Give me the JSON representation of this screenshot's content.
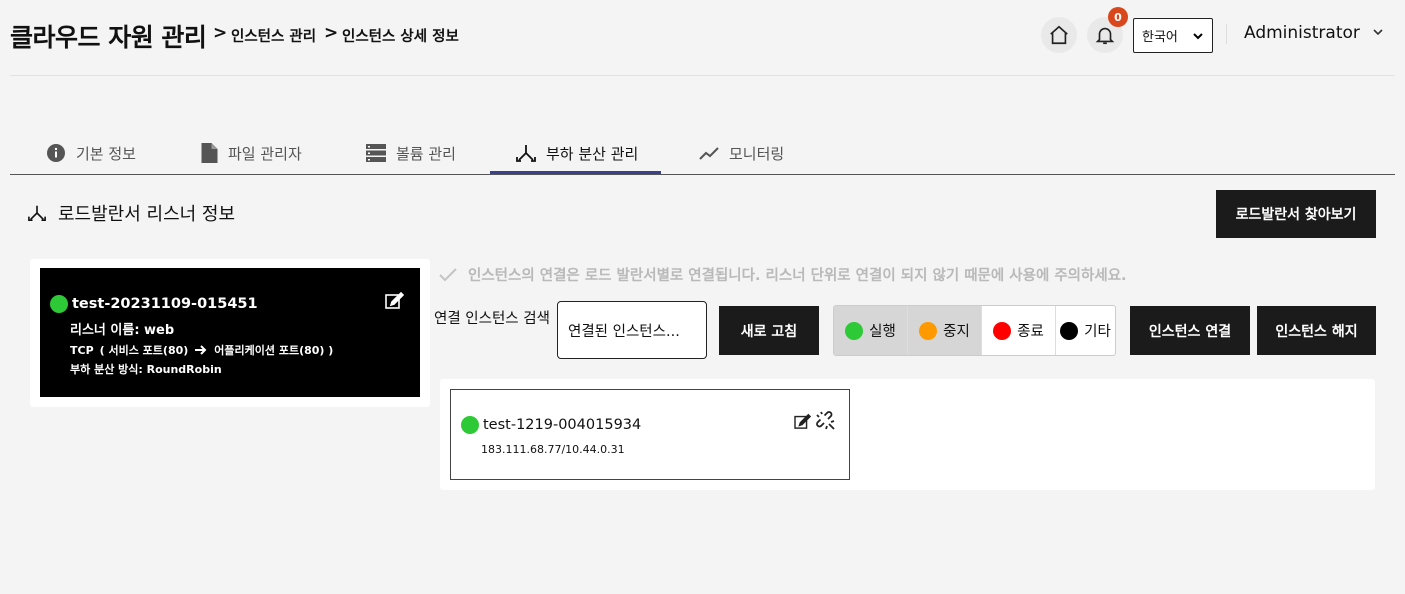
{
  "header": {
    "title": "클라우드 자원 관리",
    "breadcrumb": [
      "인스턴스 관리",
      "인스턴스 상세 정보"
    ],
    "notification_count": "0",
    "language": "한국어",
    "user": "Administrator"
  },
  "tabs": [
    {
      "label": "기본 정보",
      "icon": "info-icon"
    },
    {
      "label": "파일 관리자",
      "icon": "file-icon"
    },
    {
      "label": "볼륨 관리",
      "icon": "storage-icon"
    },
    {
      "label": "부하 분산 관리",
      "icon": "load-balancer-icon",
      "active": true
    },
    {
      "label": "모니터링",
      "icon": "chart-line-icon"
    }
  ],
  "section": {
    "title": "로드발란서 리스너 정보",
    "browse_button": "로드발란서 찾아보기"
  },
  "listener": {
    "name": "test-20231109-015451",
    "listener_name": "리스너 이름: web",
    "protocol": "TCP",
    "service_port": "( 서비스 포트(80)",
    "app_port": "어플리케이션 포트(80) )",
    "method": "부하 분산 방식: RoundRobin",
    "status_color": "#2ec936"
  },
  "notice": "인스턴스의 연결은 로드 발란서별로 연결됩니다. 리스너 단위로 연결이 되지 않기 때문에 사용에 주의하세요.",
  "search": {
    "label": "연결 인스턴스 검색",
    "value": "연결된 인스턴스...",
    "refresh_button": "새로 고침"
  },
  "filters": [
    {
      "label": "실행",
      "color": "#2ec936",
      "on": true
    },
    {
      "label": "중지",
      "color": "#ff9900",
      "on": true
    },
    {
      "label": "종료",
      "color": "#ff0000",
      "on": false
    },
    {
      "label": "기타",
      "color": "#000000",
      "on": false
    }
  ],
  "actions": {
    "connect": "인스턴스 연결",
    "disconnect": "인스턴스 해지"
  },
  "instance": {
    "name": "test-1219-004015934",
    "ip": "183.111.68.77/10.44.0.31",
    "status_color": "#2ec936"
  }
}
